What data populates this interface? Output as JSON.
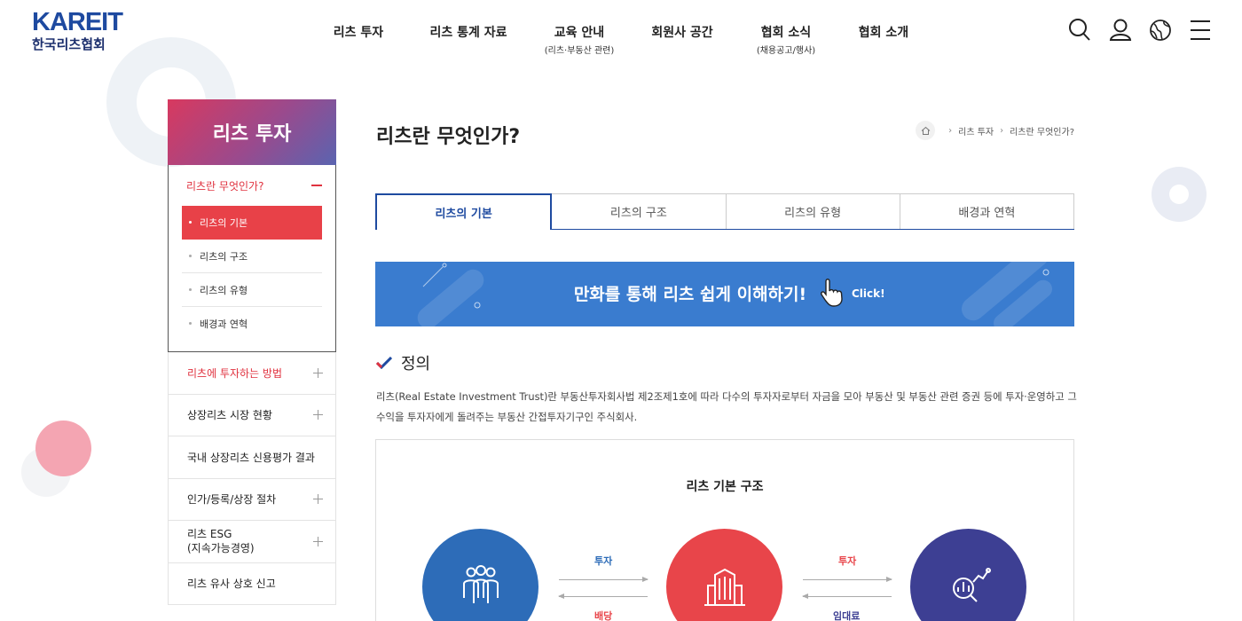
{
  "header": {
    "logo_en": "KAREIT",
    "logo_ko": "한국리츠협회",
    "nav": [
      {
        "label": "리츠 투자",
        "sub": ""
      },
      {
        "label": "리츠 통계 자료",
        "sub": ""
      },
      {
        "label": "교육 안내",
        "sub": "(리츠·부동산 관련)"
      },
      {
        "label": "회원사 공간",
        "sub": ""
      },
      {
        "label": "협회 소식",
        "sub": "(채용공고/행사)"
      },
      {
        "label": "협회 소개",
        "sub": ""
      }
    ],
    "utility_icons": [
      "search-icon",
      "user-icon",
      "globe-icon",
      "menu-icon"
    ]
  },
  "sidebar": {
    "title": "리츠 투자",
    "open_section": {
      "label": "리츠란 무엇인가?",
      "items": [
        "리츠의 기본",
        "리츠의 구조",
        "리츠의 유형",
        "배경과 연혁"
      ],
      "active_index": 0
    },
    "items": [
      {
        "label": "리츠에 투자하는 방법",
        "expandable": true
      },
      {
        "label": "상장리츠 시장 현황",
        "expandable": true
      },
      {
        "label": "국내 상장리츠 신용평가 결과",
        "expandable": false
      },
      {
        "label": "인가/등록/상장 절차",
        "expandable": true
      },
      {
        "label": "리츠 ESG\n(지속가능경영)",
        "label_line1": "리츠 ESG",
        "label_line2": "(지속가능경영)",
        "expandable": true
      },
      {
        "label": "리츠 유사 상호 신고",
        "expandable": false
      }
    ]
  },
  "main": {
    "title": "리츠란 무엇인가?",
    "breadcrumb": [
      "리츠 투자",
      "리츠란 무엇인가?"
    ],
    "tabs": [
      "리츠의 기본",
      "리츠의 구조",
      "리츠의 유형",
      "배경과 연혁"
    ],
    "active_tab": 0,
    "banner": {
      "text": "만화를 통해 리츠 쉽게 이해하기!",
      "click": "Click!"
    },
    "section_title": "정의",
    "description": "리츠(Real Estate Investment Trust)란 부동산투자회사법 제2조제1호에 따라 다수의 투자자로부터 자금을 모아 부동산 및 부동산 관련 증권 등에 투자·운영하고 그 수익을 투자자에게 돌려주는 부동산 간접투자기구인 주식회사.",
    "diagram": {
      "title": "리츠 기본 구조",
      "arrows": [
        {
          "top": "투자",
          "bottom": "배당",
          "top_color": "#2d6cb8",
          "bottom_color": "#e8454a"
        },
        {
          "top": "투자",
          "bottom": "임대료",
          "top_color": "#e8454a",
          "bottom_color": "#3d3f93"
        }
      ],
      "nodes": [
        {
          "icon": "investors-icon",
          "color": "#2d6cb8"
        },
        {
          "icon": "building-icon",
          "color": "#e8454a"
        },
        {
          "icon": "analytics-icon",
          "color": "#3d3f93"
        }
      ]
    }
  },
  "colors": {
    "brand_blue": "#1e4aa0",
    "accent_red": "#e84148",
    "banner_blue": "#3a7ccf"
  }
}
